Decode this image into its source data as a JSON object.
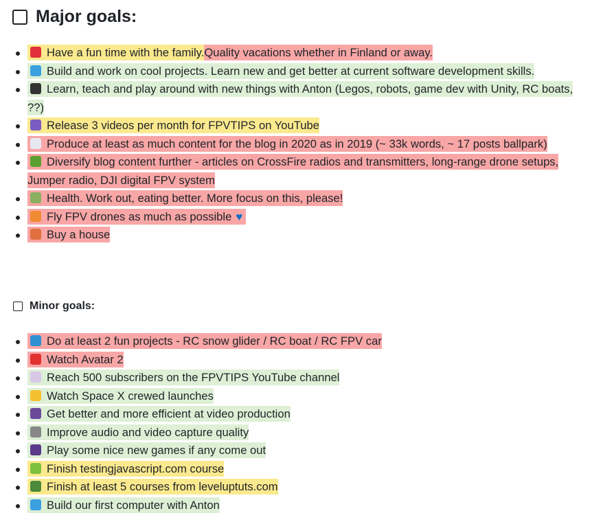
{
  "major": {
    "title": "Major goals:",
    "items": [
      {
        "icon": "balloon-icon",
        "icon_color": "#e0303a",
        "segments": [
          {
            "text": "Have a fun time with the family.",
            "color": "#fbe98e"
          },
          {
            "text": "Quality vacations whether in Finland or away.",
            "color": "#f8a6a6"
          }
        ]
      },
      {
        "icon": "laptop-icon",
        "icon_color": "#3aa0e0",
        "segments": [
          {
            "text": "Build and work on cool projects. Learn new and get better at current software development skills.",
            "color": "#ddf0d6"
          }
        ]
      },
      {
        "icon": "teacher-icon",
        "icon_color": "#333333",
        "segments": [
          {
            "text": "Learn, teach and play around with new things with Anton (Legos, robots, game dev with Unity, RC boats, ??)",
            "color": "#ddf0d6"
          }
        ]
      },
      {
        "icon": "video-camera-icon",
        "icon_color": "#7a5cc0",
        "segments": [
          {
            "text": "Release 3 videos per month for FPVTIPS on YouTube",
            "color": "#fbe98e"
          }
        ]
      },
      {
        "icon": "memo-icon",
        "icon_color": "#e8e8f0",
        "segments": [
          {
            "text": "Produce at least as much content for the blog in 2020 as in 2019 (~ 33k words, ~ 17 posts ballpark)",
            "color": "#f8a6a6"
          }
        ]
      },
      {
        "icon": "books-icon",
        "icon_color": "#5aa030",
        "segments": [
          {
            "text": "Diversify blog content further - articles on CrossFire radios and transmitters, long-range drone setups, Jumper radio, DJI digital FPV system",
            "color": "#f8a6a6"
          }
        ]
      },
      {
        "icon": "herb-icon",
        "icon_color": "#8ab060",
        "segments": [
          {
            "text": "Health. Work out, eating better. More focus on this, please!",
            "color": "#f8a6a6"
          }
        ]
      },
      {
        "icon": "helicopter-icon",
        "icon_color": "#f08a30",
        "segments": [
          {
            "text": "Fly FPV drones as much as possible",
            "color": "#f8a6a6"
          }
        ],
        "trailing_icon": "blue-heart-icon",
        "trailing_glyph": "♥"
      },
      {
        "icon": "house-icon",
        "icon_color": "#e07040",
        "segments": [
          {
            "text": "Buy a house",
            "color": "#f8a6a6"
          }
        ]
      }
    ]
  },
  "minor": {
    "title": "Minor goals:",
    "items": [
      {
        "icon": "snow-glider-icon",
        "icon_color": "#3090d0",
        "segments": [
          {
            "text": "Do at least 2 fun projects - RC snow glider / RC boat / RC FPV car",
            "color": "#f8a6a6"
          }
        ]
      },
      {
        "icon": "popcorn-icon",
        "icon_color": "#e03030",
        "segments": [
          {
            "text": "Watch Avatar 2",
            "color": "#f8a6a6"
          }
        ]
      },
      {
        "icon": "chart-increasing-icon",
        "icon_color": "#d8c8e8",
        "segments": [
          {
            "text": "Reach 500 subscribers on the FPVTIPS YouTube channel",
            "color": "#ddf0d6"
          }
        ]
      },
      {
        "icon": "crossed-fingers-icon",
        "icon_color": "#f5c030",
        "segments": [
          {
            "text": "Watch Space X crewed launches",
            "color": "#ddf0d6"
          }
        ]
      },
      {
        "icon": "videocassette-icon",
        "icon_color": "#6a4a9a",
        "segments": [
          {
            "text": "Get better and more efficient at video production",
            "color": "#ddf0d6"
          }
        ]
      },
      {
        "icon": "microphone-icon",
        "icon_color": "#888888",
        "segments": [
          {
            "text": "Improve audio and video capture quality",
            "color": "#ddf0d6"
          }
        ]
      },
      {
        "icon": "game-controller-icon",
        "icon_color": "#5a3a8a",
        "segments": [
          {
            "text": "Play some nice new games if any come out",
            "color": "#ddf0d6"
          }
        ]
      },
      {
        "icon": "test-tube-icon",
        "icon_color": "#80c040",
        "segments": [
          {
            "text": "Finish testingjavascript.com course",
            "color": "#fbe98e"
          }
        ]
      },
      {
        "icon": "teacher-icon",
        "icon_color": "#4a8a3a",
        "segments": [
          {
            "text": "Finish at least 5 courses from leveluptuts.com",
            "color": "#fbe98e"
          }
        ]
      },
      {
        "icon": "laptop-icon",
        "icon_color": "#3aa0e0",
        "segments": [
          {
            "text": "Build our first computer with Anton",
            "color": "#ddf0d6"
          }
        ]
      }
    ]
  }
}
